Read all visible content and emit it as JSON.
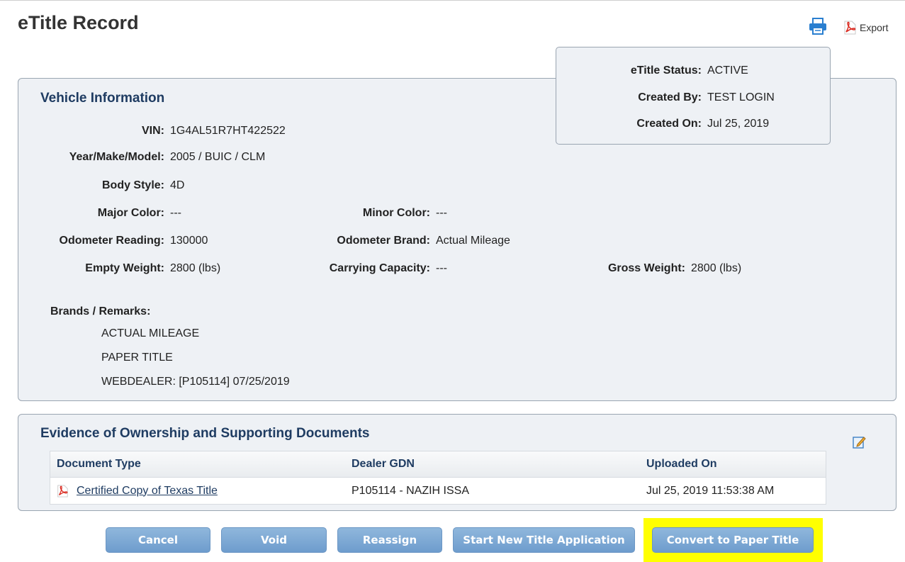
{
  "header": {
    "title": "eTitle Record",
    "export_label": "Export",
    "print_icon": "printer-icon",
    "export_icon": "pdf-icon"
  },
  "status": {
    "status_label": "eTitle Status:",
    "status_value": "ACTIVE",
    "created_by_label": "Created By:",
    "created_by_value": "TEST LOGIN",
    "created_on_label": "Created On:",
    "created_on_value": "Jul 25, 2019"
  },
  "vehicle": {
    "title": "Vehicle Information",
    "vin_label": "VIN:",
    "vin": "1G4AL51R7HT422522",
    "ymm_label": "Year/Make/Model:",
    "ymm": "2005 / BUIC / CLM",
    "body_label": "Body Style:",
    "body": "4D",
    "major_color_label": "Major Color:",
    "major_color": "---",
    "minor_color_label": "Minor Color:",
    "minor_color": "---",
    "odometer_label": "Odometer Reading:",
    "odometer": "130000",
    "odometer_brand_label": "Odometer Brand:",
    "odometer_brand": "Actual Mileage",
    "empty_weight_label": "Empty Weight:",
    "empty_weight": "2800 (lbs)",
    "carrying_label": "Carrying Capacity:",
    "carrying": "---",
    "gross_label": "Gross Weight:",
    "gross": "2800 (lbs)",
    "remarks_label": "Brands / Remarks:",
    "remarks": [
      "ACTUAL MILEAGE",
      "PAPER TITLE",
      "WEBDEALER: [P105114] 07/25/2019"
    ]
  },
  "documents": {
    "title": "Evidence of Ownership and Supporting Documents",
    "edit_icon": "edit-icon",
    "columns": [
      "Document Type",
      "Dealer GDN",
      "Uploaded On"
    ],
    "rows": [
      {
        "type": "Certified Copy of Texas Title",
        "gdn": "P105114 - NAZIH ISSA",
        "uploaded": "Jul 25, 2019 11:53:38 AM"
      }
    ]
  },
  "actions": {
    "cancel": "Cancel",
    "void": "Void",
    "reassign": "Reassign",
    "start_new": "Start New Title Application",
    "convert": "Convert to Paper Title"
  },
  "colors": {
    "panel_bg": "#eef1f5",
    "title_blue": "#1f3c62",
    "button_blue": "#7aa7d3",
    "highlight": "#ffff00"
  }
}
